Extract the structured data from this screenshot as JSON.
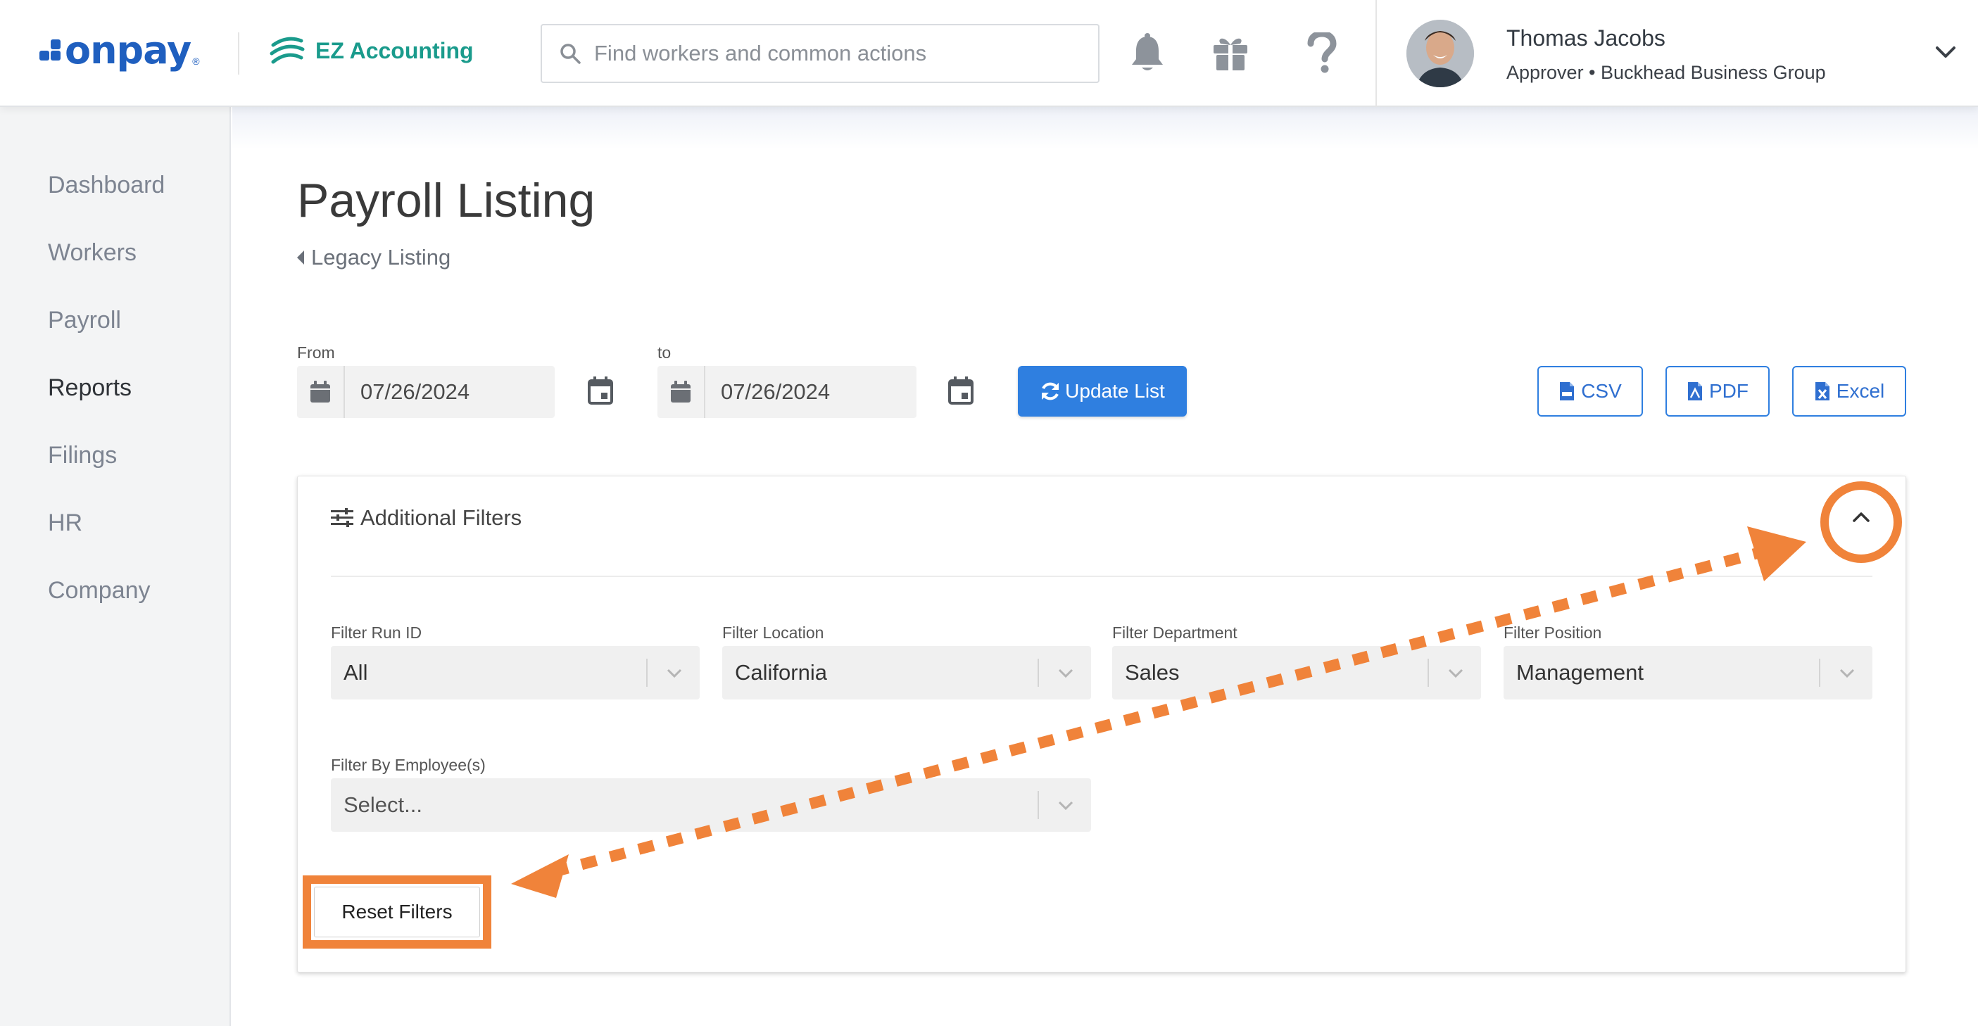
{
  "brand": {
    "logo_text": "onpay",
    "logo_reg": "®",
    "product": "EZ Accounting"
  },
  "search": {
    "placeholder": "Find workers and common actions"
  },
  "user": {
    "name": "Thomas Jacobs",
    "role": "Approver • Buckhead Business Group"
  },
  "sidebar": {
    "items": [
      {
        "label": "Dashboard"
      },
      {
        "label": "Workers"
      },
      {
        "label": "Payroll"
      },
      {
        "label": "Reports",
        "active": true
      },
      {
        "label": "Filings"
      },
      {
        "label": "HR"
      },
      {
        "label": "Company"
      }
    ]
  },
  "page": {
    "title": "Payroll Listing",
    "back_link": "Legacy Listing"
  },
  "dates": {
    "from_label": "From",
    "from_value": "07/26/2024",
    "to_label": "to",
    "to_value": "07/26/2024"
  },
  "actions": {
    "update": "Update List",
    "csv": "CSV",
    "pdf": "PDF",
    "excel": "Excel"
  },
  "filters": {
    "title": "Additional Filters",
    "run_id": {
      "label": "Filter Run ID",
      "value": "All"
    },
    "location": {
      "label": "Filter Location",
      "value": "California"
    },
    "department": {
      "label": "Filter Department",
      "value": "Sales"
    },
    "position": {
      "label": "Filter Position",
      "value": "Management"
    },
    "employees": {
      "label": "Filter By Employee(s)",
      "placeholder": "Select..."
    },
    "reset": "Reset Filters"
  },
  "colors": {
    "accent": "#2f7fe0",
    "highlight": "#f0833a",
    "brand": "#1f5fbf",
    "ez": "#1a9b8c"
  }
}
